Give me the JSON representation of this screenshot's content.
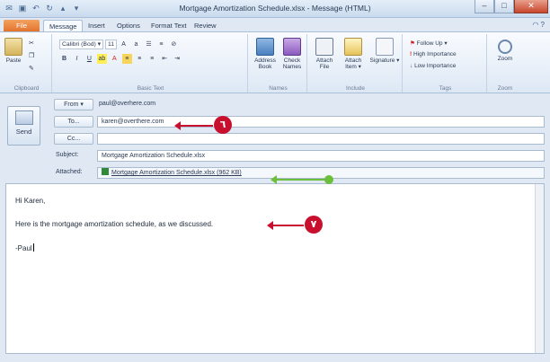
{
  "window": {
    "title": "Mortgage Amortization Schedule.xlsx - Message (HTML)"
  },
  "tabs": [
    "File",
    "Message",
    "Insert",
    "Options",
    "Format Text",
    "Review"
  ],
  "ribbon": {
    "clipboard": {
      "paste": "Paste",
      "label": "Clipboard"
    },
    "basic_text": {
      "font": "Calibri (Bod) ▾",
      "size": "11",
      "label": "Basic Text"
    },
    "names": {
      "address_book": "Address Book",
      "check_names": "Check Names",
      "label": "Names"
    },
    "include": {
      "attach_file": "Attach File",
      "attach_item": "Attach Item ▾",
      "signature": "Signature ▾",
      "label": "Include"
    },
    "tags": {
      "follow_up": "Follow Up ▾",
      "high": "High Importance",
      "low": "Low Importance",
      "label": "Tags"
    },
    "zoom": {
      "zoom": "Zoom",
      "label": "Zoom"
    }
  },
  "compose": {
    "send": "Send",
    "from_btn": "From ▾",
    "from_value": "paul@overhere.com",
    "to_btn": "To...",
    "to_value": "karen@overthere.com",
    "cc_btn": "Cc...",
    "cc_value": "",
    "subject_label": "Subject:",
    "subject_value": "Mortgage Amortization Schedule.xlsx",
    "attached_label": "Attached:",
    "attachment": "Mortgage Amortization Schedule.xlsx (962 KB)"
  },
  "body": {
    "line1": "Hi Karen,",
    "line2": "Here is the mortgage amortization schedule, as we discussed.",
    "line3": "-Paul"
  },
  "callouts": {
    "c6": "٦",
    "c7": "٧"
  },
  "colors": {
    "callout": "#c8102e",
    "green_marker": "#6bbf3b",
    "file_tab": "#e0702a"
  }
}
